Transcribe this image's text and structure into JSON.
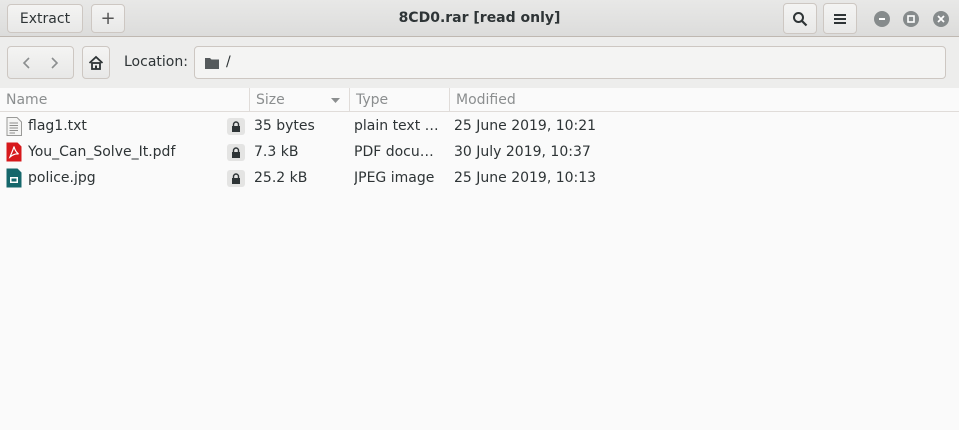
{
  "header": {
    "extract_label": "Extract",
    "add_label": "+",
    "title": "8CD0.rar [read only]"
  },
  "toolbar": {
    "location_label": "Location:",
    "location_path": "/"
  },
  "columns": [
    "Name",
    "Size",
    "Type",
    "Modified"
  ],
  "files": [
    {
      "name": "flag1.txt",
      "size": "35 bytes",
      "type": "plain text do…",
      "modified": "25 June 2019, 10:21",
      "icon": "text-file-icon"
    },
    {
      "name": "You_Can_Solve_It.pdf",
      "size": "7.3 kB",
      "type": "PDF docum…",
      "modified": "30 July 2019, 10:37",
      "icon": "pdf-file-icon"
    },
    {
      "name": "police.jpg",
      "size": "25.2 kB",
      "type": "JPEG image",
      "modified": "25 June 2019, 10:13",
      "icon": "image-file-icon"
    }
  ],
  "colors": {
    "pdf_red": "#d7191c",
    "jpeg_teal": "#15676b"
  }
}
